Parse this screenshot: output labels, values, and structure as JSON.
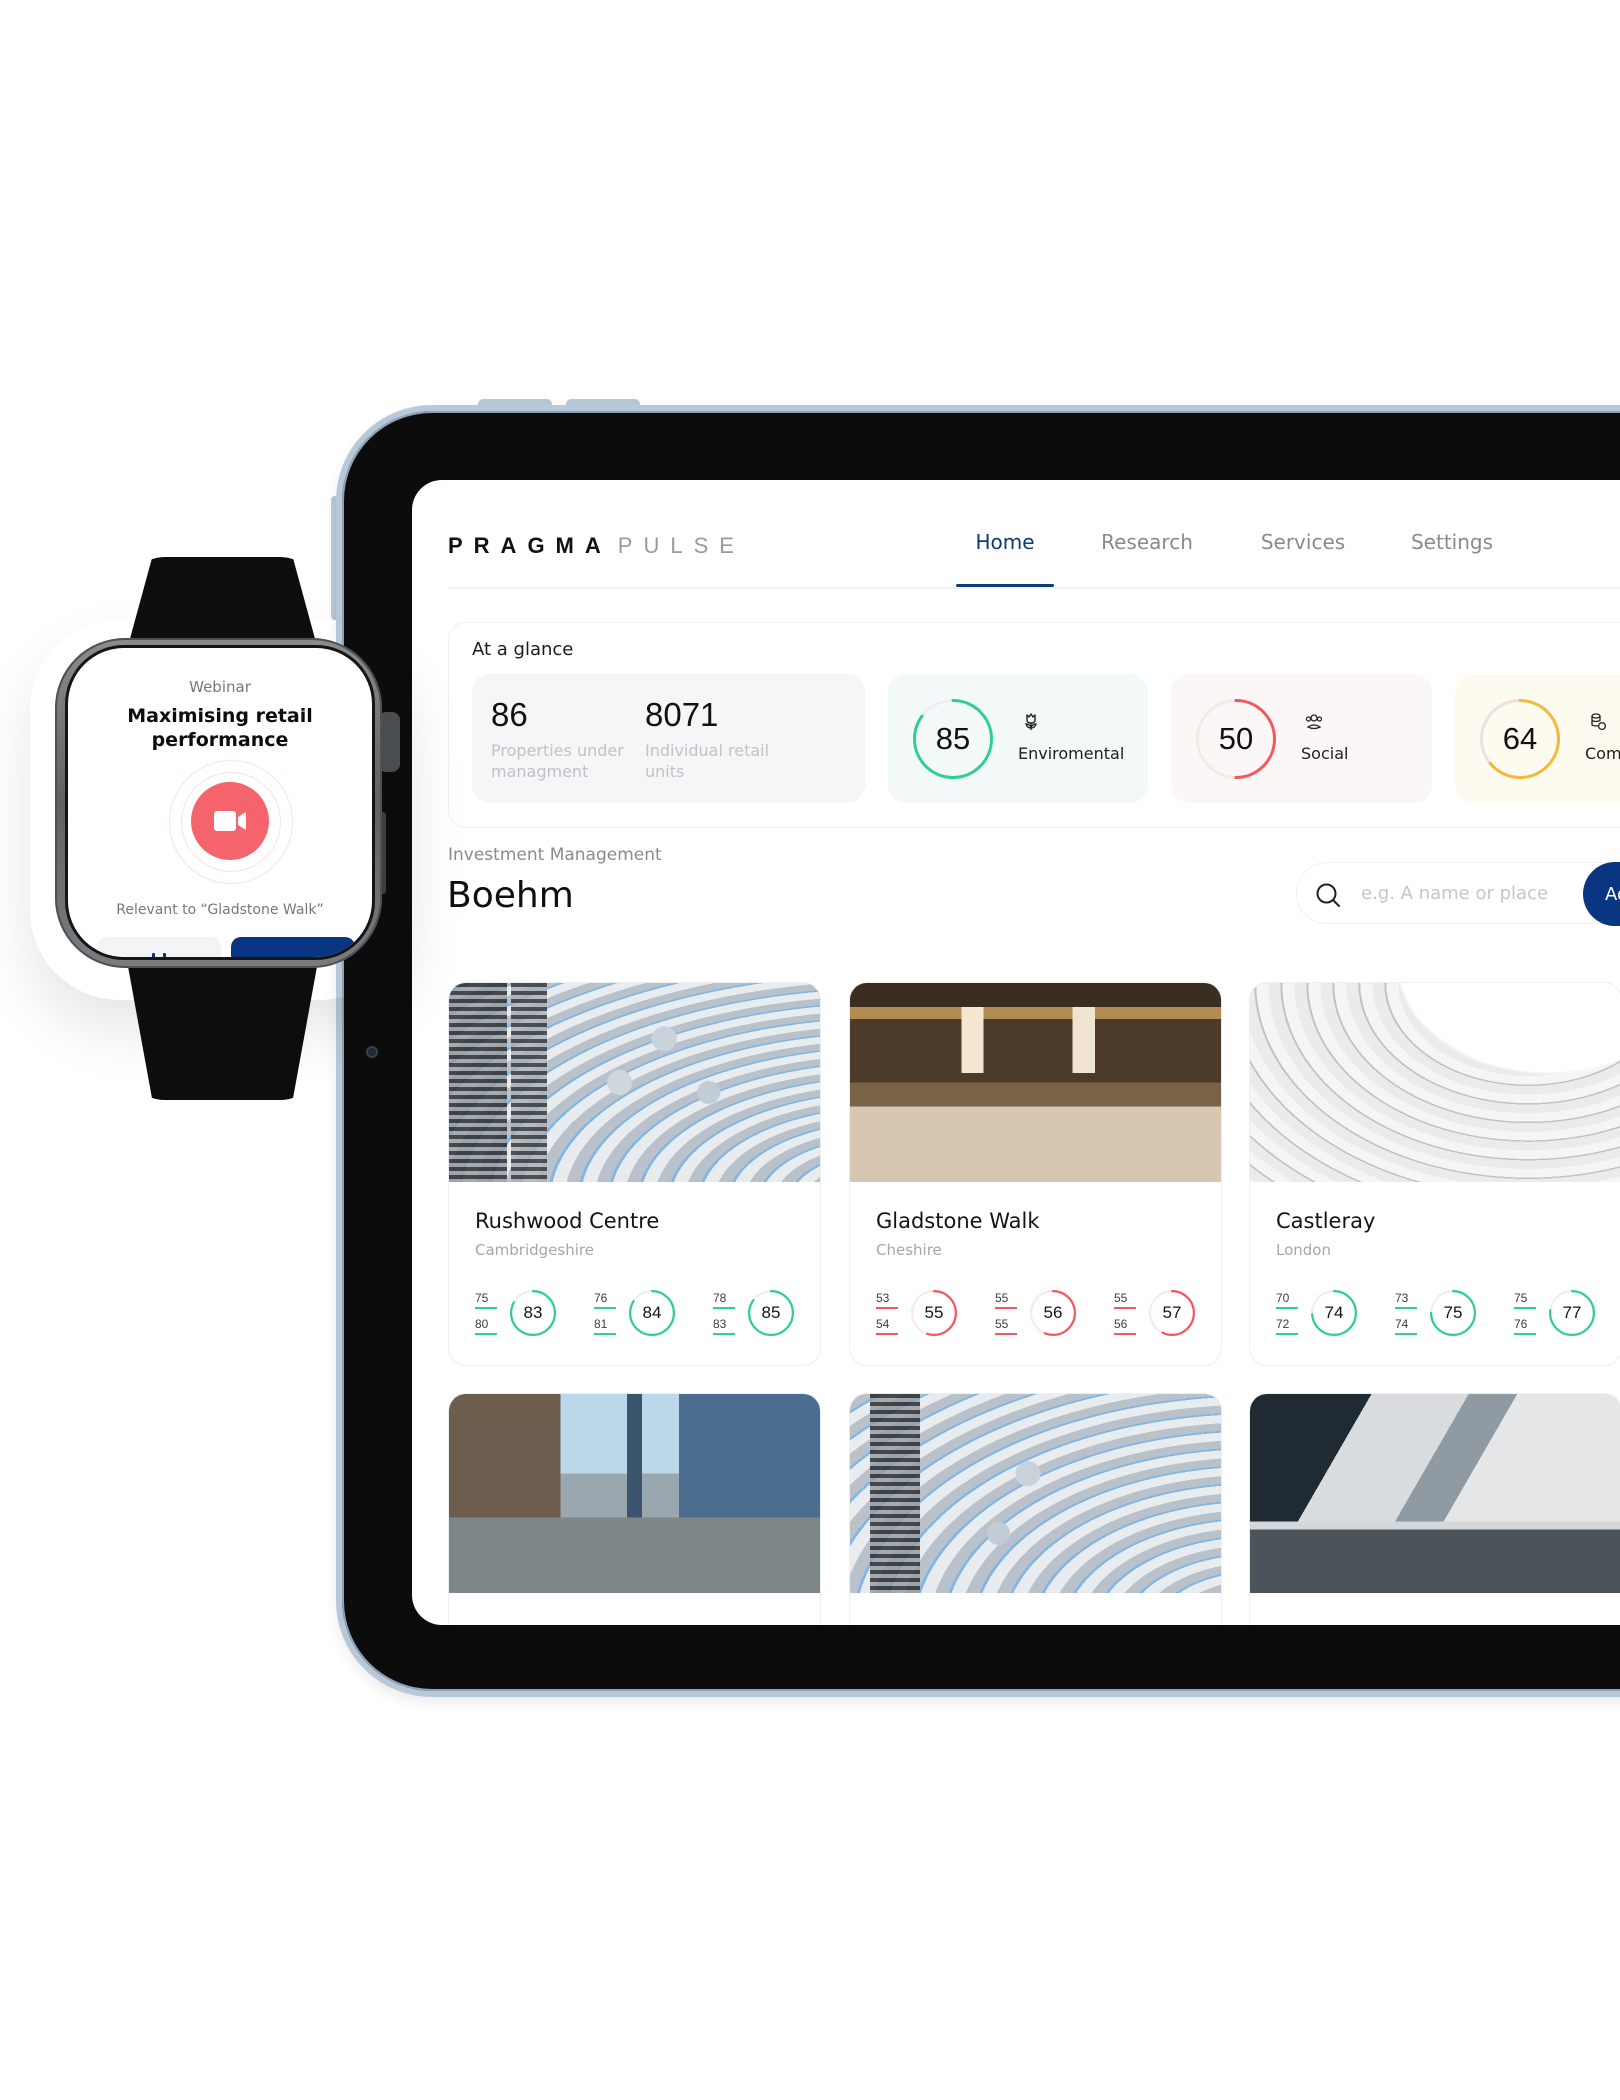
{
  "app": {
    "logo_primary": "PRAGMA",
    "logo_secondary": "PULSE"
  },
  "nav": {
    "items": [
      {
        "label": "Home",
        "active": true
      },
      {
        "label": "Research",
        "active": false
      },
      {
        "label": "Services",
        "active": false
      },
      {
        "label": "Settings",
        "active": false
      }
    ]
  },
  "glance": {
    "title": "At a glance",
    "stats": [
      {
        "value": "86",
        "label": "Properties under managment"
      },
      {
        "value": "8071",
        "label": "Individual retail units"
      }
    ],
    "scores": [
      {
        "value": "85",
        "score": 85,
        "label": "Enviromental",
        "icon": "flower-icon",
        "color": "#2fcf8f",
        "track": "#e7f0f2"
      },
      {
        "value": "50",
        "score": 50,
        "label": "Social",
        "icon": "people-icon",
        "color": "#f2595f",
        "track": "#f6e9e4"
      },
      {
        "value": "64",
        "score": 64,
        "label": "Com",
        "icon": "coins-icon",
        "color": "#f5b93a",
        "track": "#efdfe3"
      }
    ]
  },
  "section": {
    "label": "Investment Management",
    "title": "Boehm"
  },
  "search": {
    "placeholder": "e.g. A name or place",
    "value": "",
    "button_label": "Ad"
  },
  "properties": [
    {
      "name": "Rushwood Centre",
      "location": "Cambridgeshire",
      "color": "#2fcf8f",
      "track": "#e6f1f4",
      "metrics": [
        {
          "a": "75",
          "b": "80",
          "score": 83
        },
        {
          "a": "76",
          "b": "81",
          "score": 84
        },
        {
          "a": "78",
          "b": "83",
          "score": 85
        }
      ]
    },
    {
      "name": "Gladstone Walk",
      "location": "Cheshire",
      "color": "#f2595f",
      "track": "#fbe9e4",
      "metrics": [
        {
          "a": "53",
          "b": "54",
          "score": 55
        },
        {
          "a": "55",
          "b": "55",
          "score": 56
        },
        {
          "a": "55",
          "b": "56",
          "score": 57
        }
      ]
    },
    {
      "name": "Castleray",
      "location": "London",
      "color": "#2fcf8f",
      "track": "#e6f1f4",
      "metrics": [
        {
          "a": "70",
          "b": "72",
          "score": 74
        },
        {
          "a": "73",
          "b": "74",
          "score": 75
        },
        {
          "a": "75",
          "b": "76",
          "score": 77
        }
      ]
    },
    {
      "name": "",
      "location": "",
      "metrics": []
    },
    {
      "name": "",
      "location": "",
      "metrics": []
    },
    {
      "name": "",
      "location": "",
      "metrics": []
    }
  ],
  "watch": {
    "kicker": "Webinar",
    "title": "Maximising retail performance",
    "relevant": "Relevant to “Gladstone Walk”",
    "accent": "#f5636c",
    "primary": "#0a3580"
  }
}
